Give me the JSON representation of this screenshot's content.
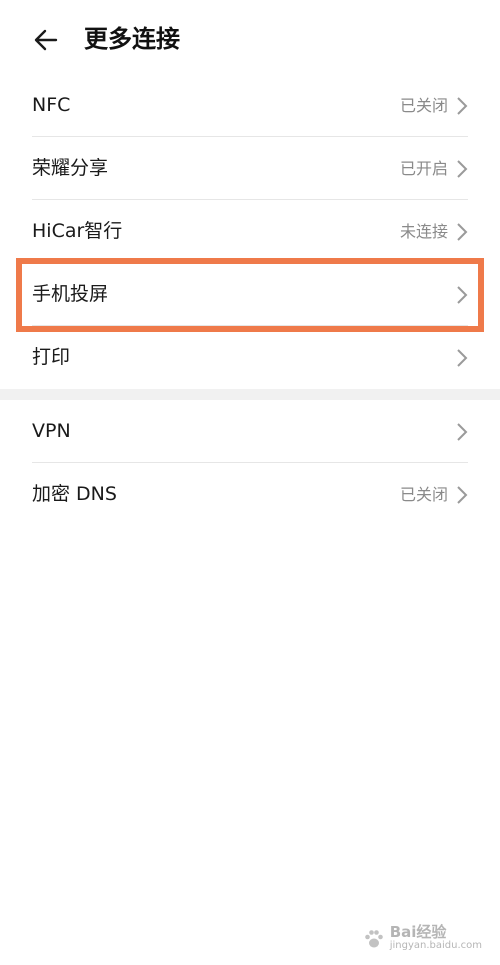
{
  "header": {
    "title": "更多连接"
  },
  "group1": [
    {
      "label": "NFC",
      "value": "已关闭"
    },
    {
      "label": "荣耀分享",
      "value": "已开启"
    },
    {
      "label": "HiCar智行",
      "value": "未连接"
    },
    {
      "label": "手机投屏",
      "value": ""
    },
    {
      "label": "打印",
      "value": ""
    }
  ],
  "group2": [
    {
      "label": "VPN",
      "value": ""
    },
    {
      "label": "加密 DNS",
      "value": "已关闭"
    }
  ],
  "highlight": {
    "color": "#ef7a4a"
  },
  "watermark": {
    "brand": "Bai经验",
    "url": "jingyan.baidu.com"
  }
}
